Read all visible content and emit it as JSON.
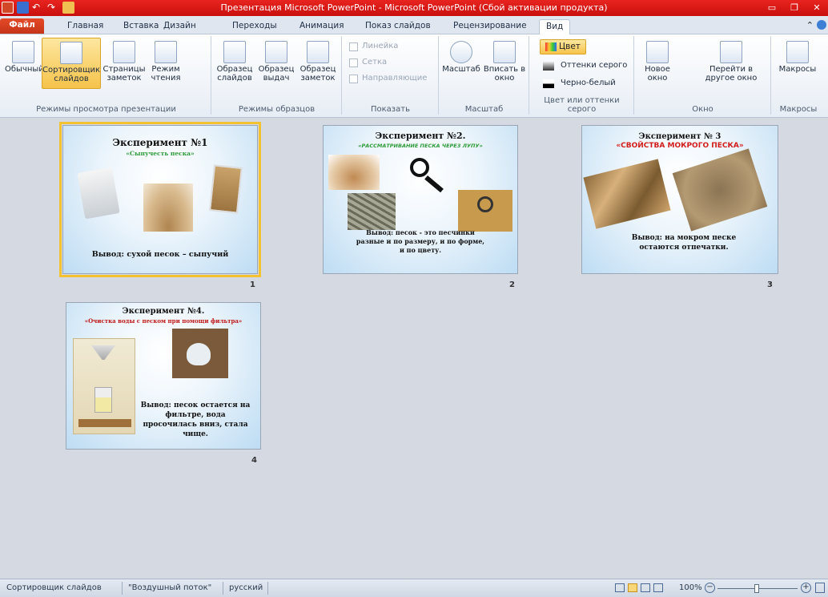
{
  "window": {
    "title": "Презентация Microsoft PowerPoint - Microsoft PowerPoint (Сбой активации продукта)"
  },
  "tabs": [
    "Файл",
    "Главная",
    "Вставка",
    "Дизайн",
    "Переходы",
    "Анимация",
    "Показ слайдов",
    "Рецензирование",
    "Вид"
  ],
  "ribbon": {
    "views": {
      "normal": "Обычный",
      "sorter": "Сортировщик слайдов",
      "notes": "Страницы заметок",
      "reading": "Режим чтения",
      "label": "Режимы просмотра презентации"
    },
    "masters": {
      "slide": "Образец слайдов",
      "handout": "Образец выдач",
      "notes": "Образец заметок",
      "label": "Режимы образцов"
    },
    "show": {
      "ruler": "Линейка",
      "grid": "Сетка",
      "guides": "Направляющие",
      "label": "Показать"
    },
    "zoom": {
      "zoom": "Масштаб",
      "fit": "Вписать в окно",
      "label": "Масштаб"
    },
    "color": {
      "color": "Цвет",
      "gray": "Оттенки серого",
      "bw": "Черно-белый",
      "label": "Цвет или оттенки серого"
    },
    "window": {
      "new": "Новое окно",
      "switch": "Перейти в другое окно",
      "label": "Окно"
    },
    "macros": {
      "macros": "Макросы",
      "label": "Макросы"
    }
  },
  "slides": [
    {
      "num": "1",
      "title": "Эксперимент №1",
      "subtitle": "«Сыпучесть песка»",
      "subtitle_color": "#2e9c3a",
      "text": "Вывод: сухой песок – сыпучий"
    },
    {
      "num": "2",
      "title": "Эксперимент №2.",
      "subtitle": "«РАССМАТРИВАНИЕ ПЕСКА ЧЕРЕЗ ЛУПУ»",
      "subtitle_color": "#2e9c3a",
      "text": "Вывод: песок - это песчинки разные и по размеру, и по форме, и по цвету."
    },
    {
      "num": "3",
      "title": "Эксперимент № 3",
      "subtitle": "«СВОЙСТВА МОКРОГО ПЕСКА»",
      "subtitle_color": "#d21c1c",
      "text": "Вывод: на мокром песке остаются отпечатки."
    },
    {
      "num": "4",
      "title": "Эксперимент №4.",
      "subtitle": "«Очистка воды с песком при помощи фильтра»",
      "subtitle_color": "#c01818",
      "text": "Вывод: песок остается на фильтре, вода просочилась вниз, стала чище."
    }
  ],
  "status": {
    "view": "Сортировщик слайдов",
    "theme": "\"Воздушный поток\"",
    "lang": "русский",
    "zoom": "100%"
  }
}
